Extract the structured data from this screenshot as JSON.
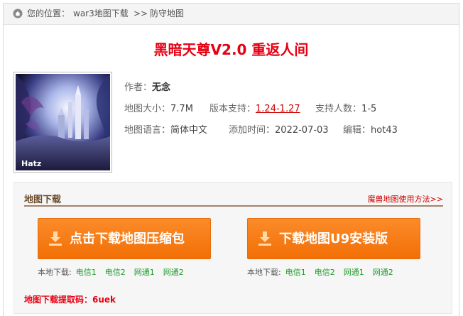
{
  "breadcrumb": {
    "prefix": "您的位置：",
    "parent": "war3地图下载",
    "separator": ">>",
    "current": "防守地图"
  },
  "map_title": "黑暗天尊V2.0 重返人间",
  "cover_logo": "Hatz",
  "info": {
    "author_label": "作者：",
    "author": "无念",
    "size_label": "地图大小：",
    "size": "7.7M",
    "version_label": "版本支持：",
    "version": "1.24-1.27",
    "players_label": "支持人数：",
    "players": "1-5",
    "language_label": "地图语言：",
    "language": "简体中文",
    "added_label": "添加时间：",
    "added": "2022-07-03",
    "editor_label": "编辑：",
    "editor": "hot43"
  },
  "download": {
    "title": "地图下载",
    "help_link": "魔兽地图使用方法>>",
    "buttons": [
      {
        "label": "点击下载地图压缩包",
        "mirror_label": "本地下载:",
        "mirrors": [
          "电信1",
          "电信2",
          "网通1",
          "网通2"
        ]
      },
      {
        "label": "下载地图U9安装版",
        "mirror_label": "本地下载:",
        "mirrors": [
          "电信1",
          "电信2",
          "网通1",
          "网通2"
        ]
      }
    ],
    "code_label": "地图下载提取码：",
    "code": "6uek"
  },
  "colors": {
    "title_red": "#e60012",
    "button_orange": "#f57a10",
    "mirror_green": "#1a9c28"
  },
  "icons": [
    "home-icon",
    "download-arrow-icon"
  ]
}
